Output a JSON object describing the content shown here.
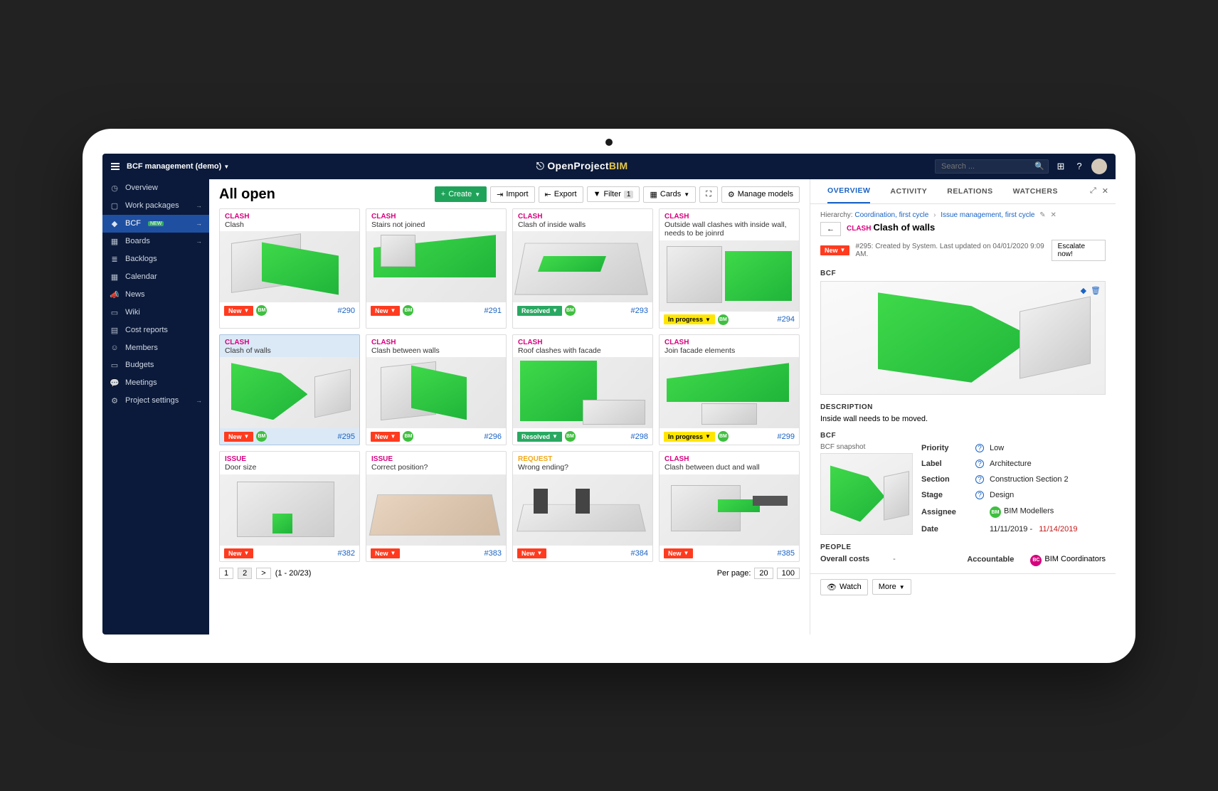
{
  "top": {
    "project": "BCF management (demo)",
    "brand1": "OpenProject",
    "brand2": "BIM",
    "search_ph": "Search ..."
  },
  "sidebar": [
    {
      "ico": "◷",
      "label": "Overview"
    },
    {
      "ico": "▢",
      "label": "Work packages",
      "arr": true
    },
    {
      "ico": "◆",
      "label": "BCF",
      "badge": "NEW",
      "arr": true,
      "active": true
    },
    {
      "ico": "▦",
      "label": "Boards",
      "arr": true
    },
    {
      "ico": "≣",
      "label": "Backlogs"
    },
    {
      "ico": "▦",
      "label": "Calendar"
    },
    {
      "ico": "📣",
      "label": "News"
    },
    {
      "ico": "▭",
      "label": "Wiki"
    },
    {
      "ico": "▤",
      "label": "Cost reports"
    },
    {
      "ico": "☺",
      "label": "Members"
    },
    {
      "ico": "▭",
      "label": "Budgets"
    },
    {
      "ico": "💬",
      "label": "Meetings"
    },
    {
      "ico": "⚙",
      "label": "Project settings",
      "arr": true
    }
  ],
  "page": {
    "title": "All open"
  },
  "toolbar": {
    "create": "Create",
    "import": "Import",
    "export": "Export",
    "filter": "Filter",
    "filter_n": "1",
    "cards": "Cards",
    "manage": "Manage models"
  },
  "cards": [
    {
      "type": "CLASH",
      "tcls": "clash",
      "title": "Clash",
      "status": "New",
      "scls": "new",
      "id": "#290",
      "av": "BM"
    },
    {
      "type": "CLASH",
      "tcls": "clash",
      "title": "Stairs not joined",
      "status": "New",
      "scls": "new",
      "id": "#291",
      "av": "BM"
    },
    {
      "type": "CLASH",
      "tcls": "clash",
      "title": "Clash of inside walls",
      "status": "Resolved",
      "scls": "resolved",
      "id": "#293",
      "av": "BM"
    },
    {
      "type": "CLASH",
      "tcls": "clash",
      "title": "Outside wall clashes with inside wall, needs to be joinrd",
      "status": "In progress",
      "scls": "progress",
      "id": "#294",
      "av": "BM"
    },
    {
      "type": "CLASH",
      "tcls": "clash",
      "title": "Clash of walls",
      "status": "New",
      "scls": "new",
      "id": "#295",
      "av": "BM",
      "sel": true
    },
    {
      "type": "CLASH",
      "tcls": "clash",
      "title": "Clash between walls",
      "status": "New",
      "scls": "new",
      "id": "#296",
      "av": "BM"
    },
    {
      "type": "CLASH",
      "tcls": "clash",
      "title": "Roof clashes with facade",
      "status": "Resolved",
      "scls": "resolved",
      "id": "#298",
      "av": "BM"
    },
    {
      "type": "CLASH",
      "tcls": "clash",
      "title": "Join facade elements",
      "status": "In progress",
      "scls": "progress",
      "id": "#299",
      "av": "BM"
    },
    {
      "type": "ISSUE",
      "tcls": "issue",
      "title": "Door size",
      "status": "New",
      "scls": "new",
      "id": "#382"
    },
    {
      "type": "ISSUE",
      "tcls": "issue",
      "title": "Correct position?",
      "status": "New",
      "scls": "new",
      "id": "#383"
    },
    {
      "type": "REQUEST",
      "tcls": "request",
      "title": "Wrong ending?",
      "status": "New",
      "scls": "new",
      "id": "#384"
    },
    {
      "type": "CLASH",
      "tcls": "clash",
      "title": "Clash between duct and wall",
      "status": "New",
      "scls": "new",
      "id": "#385"
    }
  ],
  "pager": {
    "pages": [
      "1",
      "2"
    ],
    "caret": ">",
    "info": "(1 - 20/23)",
    "perpage": "Per page:",
    "pp1": "20",
    "pp2": "100"
  },
  "detailTabs": {
    "overview": "OVERVIEW",
    "activity": "ACTIVITY",
    "relations": "RELATIONS",
    "watchers": "WATCHERS"
  },
  "detail": {
    "hier": "Hierarchy:",
    "bc1": "Coordination, first cycle",
    "bc2": "Issue management, first cycle",
    "type": "CLASH",
    "title": "Clash of walls",
    "status": "New",
    "meta": "#295: Created by System. Last updated on 04/01/2020 9:09 AM.",
    "escalate": "Escalate now!",
    "bcf_h": "BCF",
    "desc_h": "DESCRIPTION",
    "desc": "Inside wall needs to be moved.",
    "bcf2_h": "BCF",
    "snapshot": "BCF snapshot",
    "f_priority": "Priority",
    "v_priority": "Low",
    "f_label": "Label",
    "v_label": "Architecture",
    "f_section": "Section",
    "v_section": "Construction Section 2",
    "f_stage": "Stage",
    "v_stage": "Design",
    "f_assignee": "Assignee",
    "v_assignee": "BIM Modellers",
    "f_date": "Date",
    "v_date": "11/11/2019",
    "v_date_late": "11/14/2019",
    "people_h": "PEOPLE",
    "overall": "Overall costs",
    "overall_v": "-",
    "acct": "Accountable",
    "acct_v": "BIM Coordinators",
    "watch": "Watch",
    "more": "More"
  }
}
